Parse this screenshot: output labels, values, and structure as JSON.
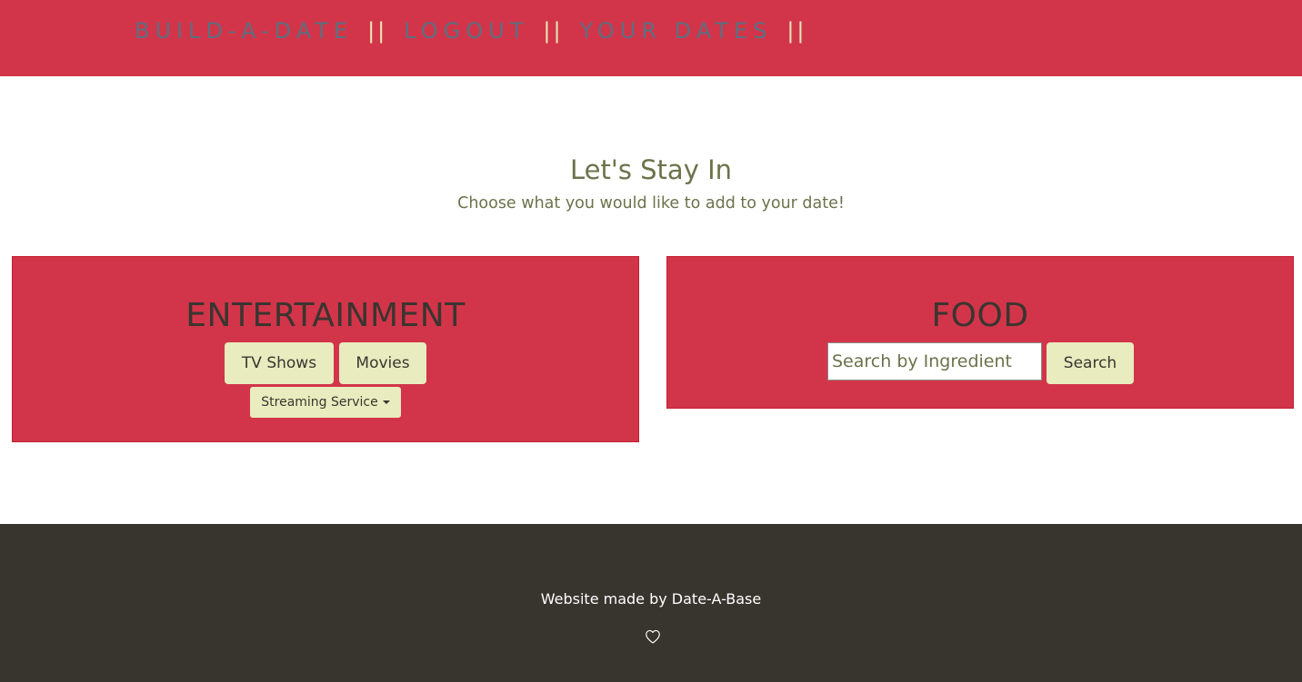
{
  "nav": {
    "items": [
      {
        "label": "BUILD-A-DATE"
      },
      {
        "label": "LOGOUT"
      },
      {
        "label": "YOUR DATES"
      }
    ],
    "separator": "||"
  },
  "hero": {
    "title": "Let's Stay In",
    "subtitle": "Choose what you would like to add to your date!"
  },
  "entertainment": {
    "title": "ENTERTAINMENT",
    "tv_label": "TV Shows",
    "movies_label": "Movies",
    "streaming_label": "Streaming Service"
  },
  "food": {
    "title": "FOOD",
    "search_placeholder": "Search by Ingredient",
    "search_value": "",
    "search_button": "Search"
  },
  "footer": {
    "text": "Website made by Date-A-Base",
    "icon": "heart-icon"
  },
  "colors": {
    "brand_red": "#d23549",
    "nav_link": "#5c6e80",
    "button_bg": "#e8ecbe",
    "heading_olive": "#6b734b",
    "footer_bg": "#38342e"
  }
}
